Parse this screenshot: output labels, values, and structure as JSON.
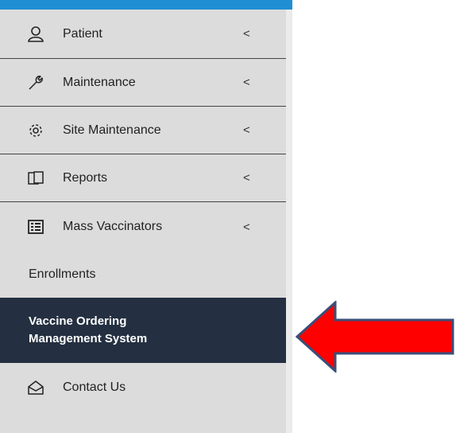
{
  "sidebar": {
    "items": [
      {
        "label": "Patient",
        "icon": "user-icon",
        "chevron": "<"
      },
      {
        "label": "Maintenance",
        "icon": "wrench-icon",
        "chevron": "<"
      },
      {
        "label": "Site Maintenance",
        "icon": "gear-icon",
        "chevron": "<"
      },
      {
        "label": "Reports",
        "icon": "reports-icon",
        "chevron": "<"
      },
      {
        "label": "Mass Vaccinators",
        "icon": "list-icon",
        "chevron": "<"
      },
      {
        "label": "Enrollments"
      },
      {
        "label_line1": "Vaccine Ordering",
        "label_line2": "Management System",
        "active": true
      },
      {
        "label": "Contact Us",
        "icon": "envelope-icon"
      }
    ]
  },
  "colors": {
    "sidebar_bg": "#dcdcdc",
    "top_accent": "#1f8fd3",
    "active_bg": "#243041",
    "arrow_fill": "#ff0000",
    "arrow_stroke": "#3a4f7a"
  },
  "annotation": {
    "icon": "arrow-left-icon"
  }
}
